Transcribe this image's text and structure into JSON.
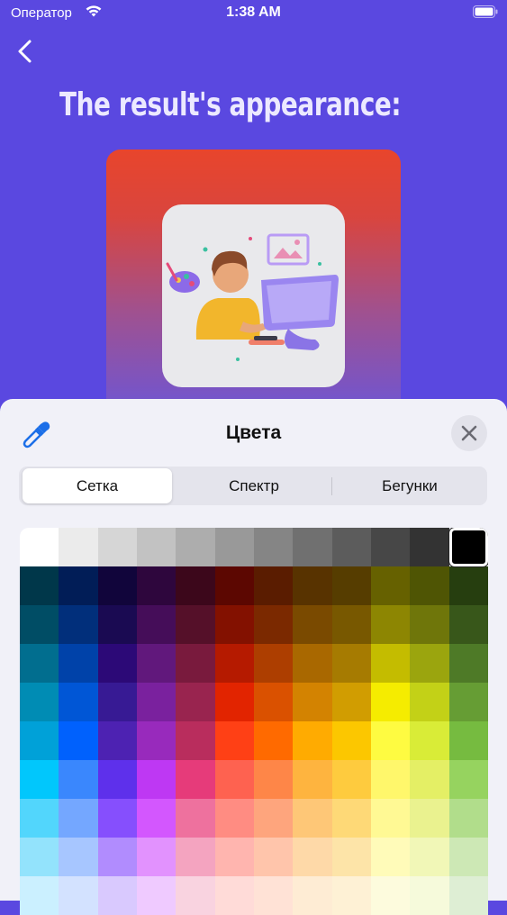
{
  "status_bar": {
    "carrier": "Оператор",
    "time": "1:38 AM"
  },
  "page": {
    "title": "The result's appearance:"
  },
  "sheet": {
    "title": "Цвета",
    "tabs": [
      "Сетка",
      "Спектр",
      "Бегунки"
    ],
    "selected_tab": "Сетка",
    "selected_color": "#000000"
  },
  "colors": {
    "grid": [
      [
        "#ffffff",
        "#ebebeb",
        "#d6d6d6",
        "#c2c2c2",
        "#adadad",
        "#999999",
        "#858585",
        "#707070",
        "#5c5c5c",
        "#474747",
        "#333333",
        "#000000"
      ],
      [
        "#00374a",
        "#011d57",
        "#11053b",
        "#2e063d",
        "#3c071b",
        "#5c0701",
        "#5a1c00",
        "#583300",
        "#563d00",
        "#666100",
        "#4f5504",
        "#263e0f"
      ],
      [
        "#004d65",
        "#012f7b",
        "#1a0a52",
        "#450d59",
        "#551029",
        "#831100",
        "#7b2900",
        "#7a4a00",
        "#785800",
        "#8d8602",
        "#6f760a",
        "#38571a"
      ],
      [
        "#016e8f",
        "#0042a9",
        "#2c0977",
        "#61187c",
        "#791a3d",
        "#b51a00",
        "#ad3e00",
        "#a96800",
        "#a67b01",
        "#c4bc00",
        "#9ba50e",
        "#4e7a27"
      ],
      [
        "#008cb4",
        "#0056d6",
        "#371a94",
        "#7a219e",
        "#99244f",
        "#e22400",
        "#da5100",
        "#d38301",
        "#d19d01",
        "#f5ec00",
        "#c3d117",
        "#669d34"
      ],
      [
        "#00a1d8",
        "#0061fd",
        "#4d22b2",
        "#982abc",
        "#b92d5d",
        "#ff4015",
        "#ff6a00",
        "#ffab01",
        "#fcc700",
        "#fefb41",
        "#d9ec37",
        "#76bb40"
      ],
      [
        "#01c7fc",
        "#3a87fd",
        "#5e30eb",
        "#be38f3",
        "#e63b7a",
        "#fe6250",
        "#fe8648",
        "#feb43f",
        "#fecb3e",
        "#fff76b",
        "#e4ef65",
        "#96d35f"
      ],
      [
        "#52d6fc",
        "#74a7ff",
        "#864ffd",
        "#d357fe",
        "#ee719e",
        "#ff8c82",
        "#fea57d",
        "#fec777",
        "#fed977",
        "#fff994",
        "#eaf28f",
        "#b1dd8b"
      ],
      [
        "#93e3fc",
        "#a7c6ff",
        "#b18cfe",
        "#e292fe",
        "#f4a4c0",
        "#ffb5af",
        "#ffc5ab",
        "#fed9a8",
        "#fde4a8",
        "#fffbb9",
        "#f1f7b7",
        "#cde8b5"
      ],
      [
        "#cbf0ff",
        "#d3e2ff",
        "#d9c9fe",
        "#efcaff",
        "#f9d3e0",
        "#ffdbd8",
        "#ffe2d6",
        "#feecd4",
        "#fef1d5",
        "#fdfbdd",
        "#f6fadb",
        "#deeed4"
      ]
    ]
  }
}
